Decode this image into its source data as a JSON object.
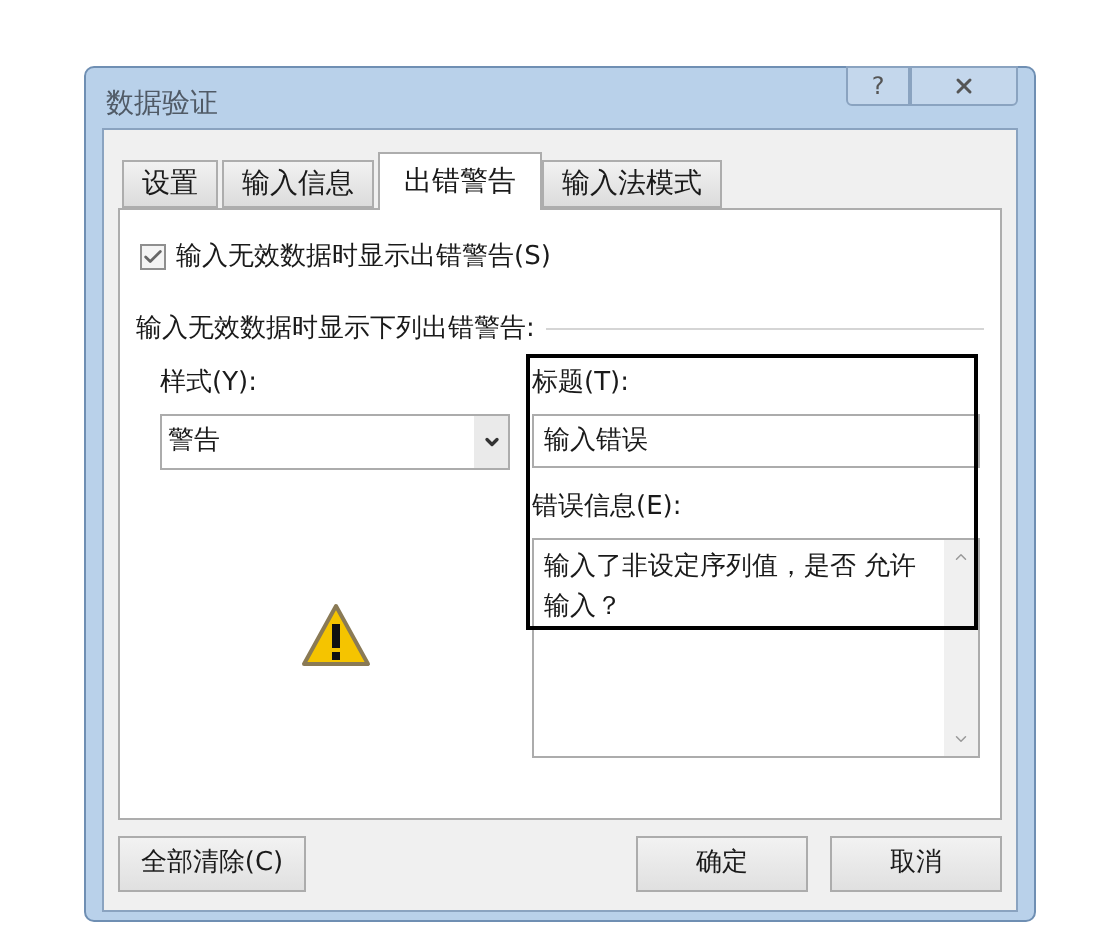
{
  "window": {
    "title": "数据验证",
    "help_button": "?"
  },
  "tabs": [
    {
      "label": "设置",
      "selected": false
    },
    {
      "label": "输入信息",
      "selected": false
    },
    {
      "label": "出错警告",
      "selected": true
    },
    {
      "label": "输入法模式",
      "selected": false
    }
  ],
  "show_alert": {
    "label": "输入无效数据时显示出错警告(S)",
    "checked": true
  },
  "section_label": "输入无效数据时显示下列出错警告:",
  "style": {
    "label": "样式(Y):",
    "value": "警告"
  },
  "title_field": {
    "label": "标题(T):",
    "value": "输入错误"
  },
  "message_field": {
    "label": "错误信息(E):",
    "value": "输入了非设定序列值，是否 允许输入？"
  },
  "buttons": {
    "clear_all": "全部清除(C)",
    "ok": "确定",
    "cancel": "取消"
  }
}
